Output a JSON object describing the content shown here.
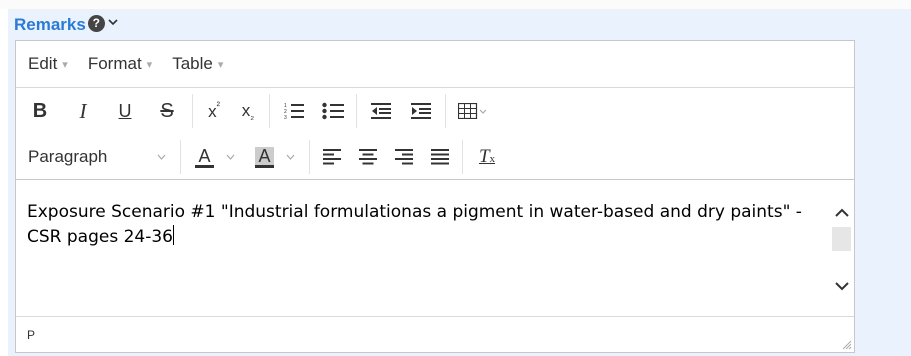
{
  "field": {
    "label": "Remarks",
    "help_icon": "question-circle-icon",
    "help_glyph": "?",
    "expand_icon": "chevron-down-icon"
  },
  "menubar": {
    "items": [
      {
        "label": "Edit",
        "caret": "▾"
      },
      {
        "label": "Format",
        "caret": "▾"
      },
      {
        "label": "Table",
        "caret": "▾"
      }
    ]
  },
  "toolbar": {
    "bold": "B",
    "italic": "I",
    "underline": "U",
    "strikethrough": "S",
    "superscript": {
      "base": "x",
      "mark": "²"
    },
    "subscript": {
      "base": "x",
      "mark": "₂"
    },
    "block_format": "Paragraph",
    "text_color": "A",
    "background_color": "A",
    "clear_format": "T",
    "icons": [
      "bold-icon",
      "italic-icon",
      "underline-icon",
      "strikethrough-icon",
      "superscript-icon",
      "subscript-icon",
      "numbered-list-icon",
      "bullet-list-icon",
      "outdent-icon",
      "indent-icon",
      "table-icon",
      "text-color-icon",
      "background-color-icon",
      "align-left-icon",
      "align-center-icon",
      "align-right-icon",
      "align-justify-icon",
      "clear-formatting-icon"
    ]
  },
  "content": {
    "text": "Exposure Scenario #1 \"Industrial formulationas a pigment in water-based and dry paints\" - CSR pages 24-36"
  },
  "statusbar": {
    "path": "P"
  },
  "colors": {
    "label": "#2a7ad6",
    "panel": "#e9f2fd",
    "border": "#c7c7c7"
  }
}
